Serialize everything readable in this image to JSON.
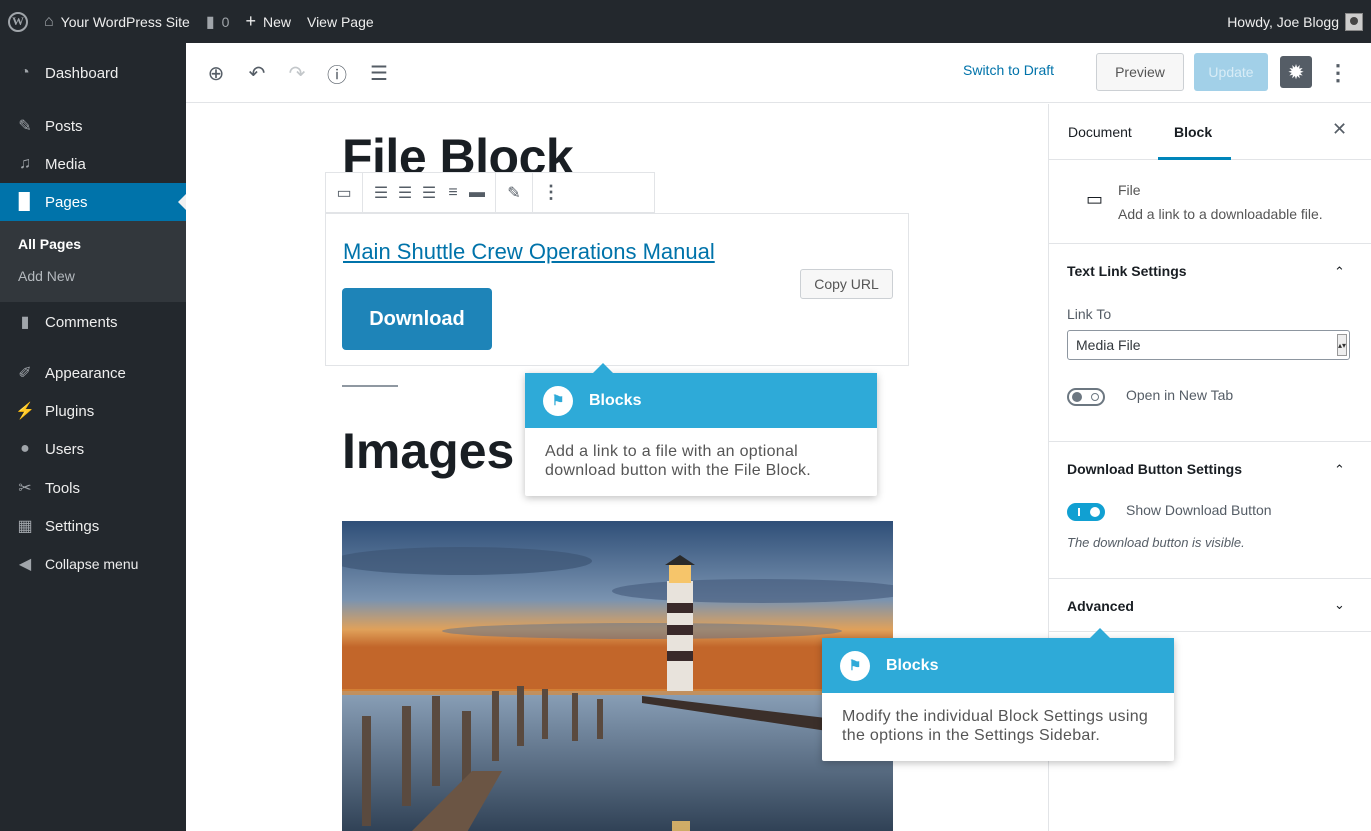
{
  "adminbar": {
    "site_name": "Your WordPress Site",
    "comments_count": "0",
    "new_label": "New",
    "view_page_label": "View Page",
    "howdy": "Howdy, Joe Blogg"
  },
  "menu": {
    "items": [
      {
        "label": "Dashboard",
        "icon": "dashboard-icon"
      },
      {
        "label": "Posts",
        "icon": "pin-icon"
      },
      {
        "label": "Media",
        "icon": "media-icon"
      },
      {
        "label": "Pages",
        "icon": "pages-icon"
      },
      {
        "label": "Comments",
        "icon": "comment-icon"
      },
      {
        "label": "Appearance",
        "icon": "brush-icon"
      },
      {
        "label": "Plugins",
        "icon": "plugin-icon"
      },
      {
        "label": "Users",
        "icon": "users-icon"
      },
      {
        "label": "Tools",
        "icon": "wrench-icon"
      },
      {
        "label": "Settings",
        "icon": "settings-icon"
      }
    ],
    "submenu": [
      "All Pages",
      "Add New"
    ],
    "collapse_label": "Collapse menu"
  },
  "header": {
    "switch_to_draft": "Switch to Draft",
    "preview": "Preview",
    "update": "Update"
  },
  "editor": {
    "title": "File Block",
    "file_link": "Main Shuttle Crew Operations Manual",
    "copy_url": "Copy URL",
    "download": "Download",
    "images_heading": "Images"
  },
  "sidebar": {
    "tabs": [
      "Document",
      "Block"
    ],
    "active_tab": "Block",
    "block_name": "File",
    "block_description": "Add a link to a downloadable file.",
    "text_link_settings": {
      "title": "Text Link Settings",
      "link_to_label": "Link To",
      "link_to_value": "Media File",
      "open_new_tab_label": "Open in New Tab",
      "open_new_tab": false
    },
    "download_button_settings": {
      "title": "Download Button Settings",
      "show_label": "Show Download Button",
      "show": true,
      "help": "The download button is visible."
    },
    "advanced_title": "Advanced"
  },
  "tooltips": [
    {
      "title": "Blocks",
      "body": "Add a link to a file with an optional download button with the File Block."
    },
    {
      "title": "Blocks",
      "body": "Modify the individual Block Settings using the options in the Settings Sidebar."
    }
  ],
  "colors": {
    "admin_dark": "#23282d",
    "admin_blue": "#0073aa",
    "tooltip_blue": "#2eaad8",
    "download_blue": "#1e84b8"
  }
}
